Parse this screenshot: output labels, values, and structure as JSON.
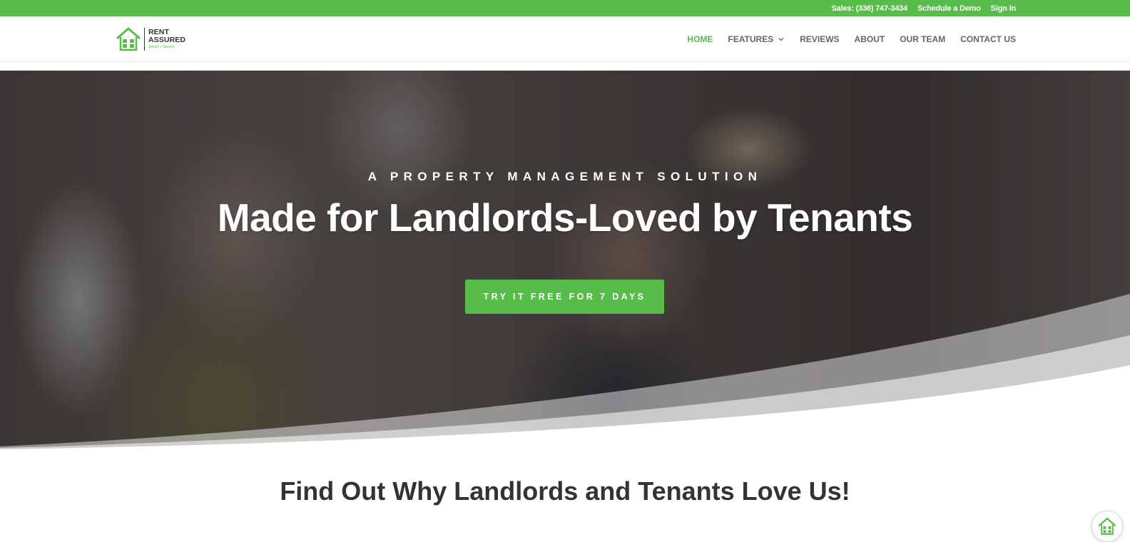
{
  "topbar": {
    "sales": "Sales: (336) 747-3434",
    "demo": "Schedule a Demo",
    "signin": "Sign In"
  },
  "brand": {
    "line1": "RENT",
    "line2": "ASSURED",
    "tagline": "Smart • Secure",
    "accent_color": "#57bc4a"
  },
  "nav": {
    "home": "HOME",
    "features": "FEATURES",
    "reviews": "REVIEWS",
    "about": "ABOUT",
    "team": "OUR TEAM",
    "contact": "CONTACT US"
  },
  "hero": {
    "eyebrow": "A PROPERTY MANAGEMENT SOLUTION",
    "headline": "Made for Landlords-Loved by Tenants",
    "cta": "TRY IT FREE FOR 7 DAYS"
  },
  "section": {
    "title": "Find Out Why Landlords and Tenants Love Us!"
  },
  "icons": {
    "logo": "house-icon",
    "features_chevron": "chevron-down-icon",
    "chat": "house-chat-icon"
  }
}
